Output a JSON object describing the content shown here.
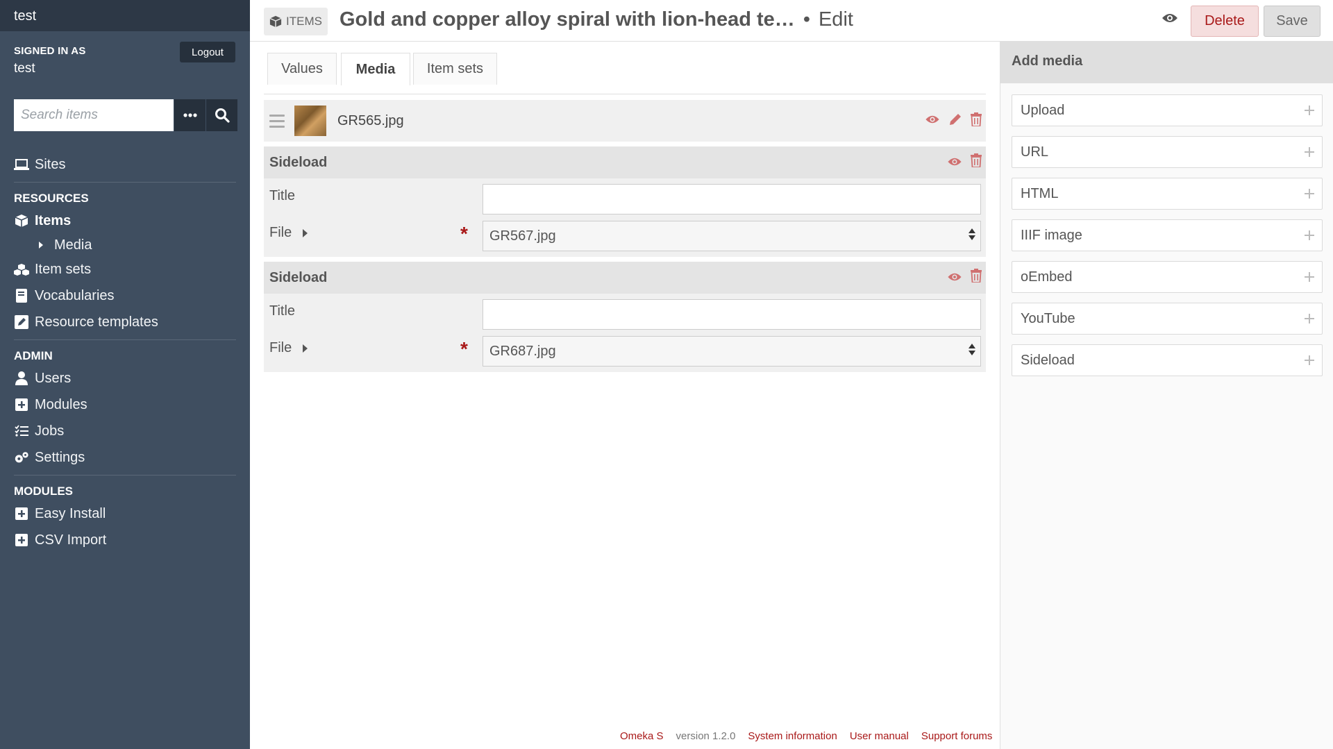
{
  "app": {
    "name": "test"
  },
  "user": {
    "signed_in_label": "SIGNED IN AS",
    "name": "test",
    "logout_label": "Logout"
  },
  "search": {
    "placeholder": "Search items"
  },
  "nav": {
    "sites": "Sites",
    "resources_heading": "RESOURCES",
    "items": "Items",
    "media": "Media",
    "item_sets": "Item sets",
    "vocabularies": "Vocabularies",
    "resource_templates": "Resource templates",
    "admin_heading": "ADMIN",
    "users": "Users",
    "modules": "Modules",
    "jobs": "Jobs",
    "settings": "Settings",
    "modules_heading": "MODULES",
    "easy_install": "Easy Install",
    "csv_import": "CSV Import"
  },
  "header": {
    "breadcrumb": "ITEMS",
    "title": "Gold and copper alloy spiral with lion-head te…",
    "separator": "•",
    "action": "Edit",
    "delete_label": "Delete",
    "save_label": "Save"
  },
  "tabs": [
    "Values",
    "Media",
    "Item sets"
  ],
  "media": {
    "existing": {
      "filename": "GR565.jpg"
    },
    "sideloads": [
      {
        "heading": "Sideload",
        "title_label": "Title",
        "title_value": "",
        "file_label": "File",
        "file_value": "GR567.jpg"
      },
      {
        "heading": "Sideload",
        "title_label": "Title",
        "title_value": "",
        "file_label": "File",
        "file_value": "GR687.jpg"
      }
    ]
  },
  "add_media": {
    "heading": "Add media",
    "options": [
      "Upload",
      "URL",
      "HTML",
      "IIIF image",
      "oEmbed",
      "YouTube",
      "Sideload"
    ]
  },
  "footer": {
    "product": "Omeka S",
    "version": "version 1.2.0",
    "system_info": "System information",
    "user_manual": "User manual",
    "support": "Support forums"
  },
  "colors": {
    "sidebar": "#3f4e60",
    "danger": "#a91919",
    "icon_red": "#d07070"
  }
}
